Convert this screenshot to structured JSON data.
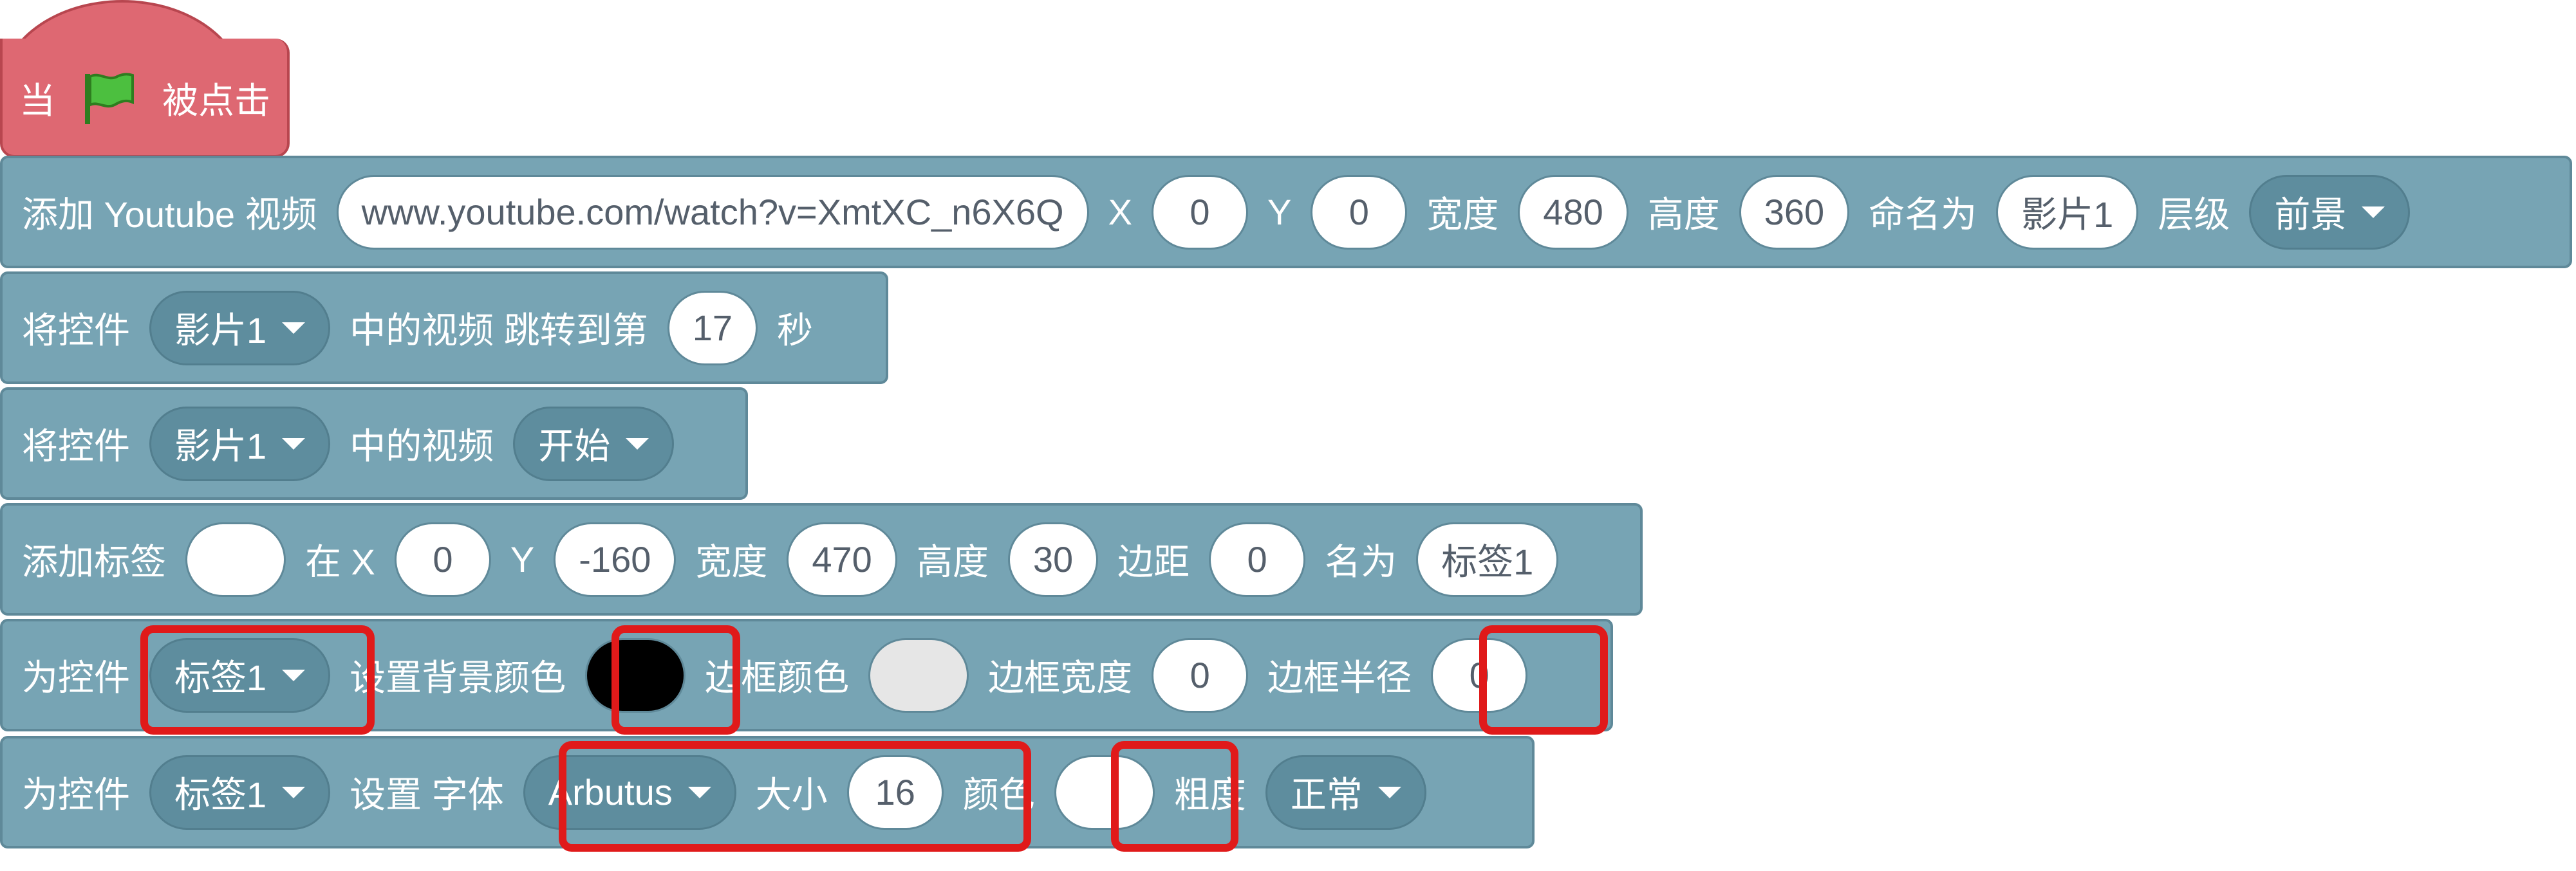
{
  "hat": {
    "prefix": "当",
    "icon": "green-flag-icon",
    "suffix": "被点击"
  },
  "youtube_block": {
    "label": "添加 Youtube 视频",
    "url": "www.youtube.com/watch?v=XmtXC_n6X6Q",
    "x_label": "X",
    "x": "0",
    "y_label": "Y",
    "y": "0",
    "width_label": "宽度",
    "width": "480",
    "height_label": "高度",
    "height": "360",
    "name_label": "命名为",
    "name": "影片1",
    "layer_label": "层级",
    "layer": "前景"
  },
  "seek_block": {
    "prefix": "将控件",
    "target": "影片1",
    "middle": "中的视频 跳转到第",
    "seconds": "17",
    "suffix": "秒"
  },
  "play_block": {
    "prefix": "将控件",
    "target": "影片1",
    "middle": "中的视频",
    "action": "开始"
  },
  "label_block": {
    "label": "添加标签",
    "text": "",
    "x_label": "在 X",
    "x": "0",
    "y_label": "Y",
    "y": "-160",
    "width_label": "宽度",
    "width": "470",
    "height_label": "高度",
    "height": "30",
    "padding_label": "边距",
    "padding": "0",
    "name_label": "名为",
    "name": "标签1"
  },
  "bg_block": {
    "prefix": "为控件",
    "target": "标签1",
    "bg_label": "设置背景颜色",
    "bg_color": "#000000",
    "border_color_label": "边框颜色",
    "border_color": "#e6e6e6",
    "border_width_label": "边框宽度",
    "border_width": "0",
    "border_radius_label": "边框半径",
    "border_radius": "0"
  },
  "font_block": {
    "prefix": "为控件",
    "target": "标签1",
    "font_label": "设置 字体",
    "font": "Arbutus",
    "size_label": "大小",
    "size": "16",
    "color_label": "颜色",
    "color": "#ffffff",
    "weight_label": "粗度",
    "weight": "正常"
  },
  "colors": {
    "hat": "#de6872",
    "block": "#77a4b4",
    "dropdown": "#5e8d9e",
    "highlight": "#e01a1a"
  }
}
